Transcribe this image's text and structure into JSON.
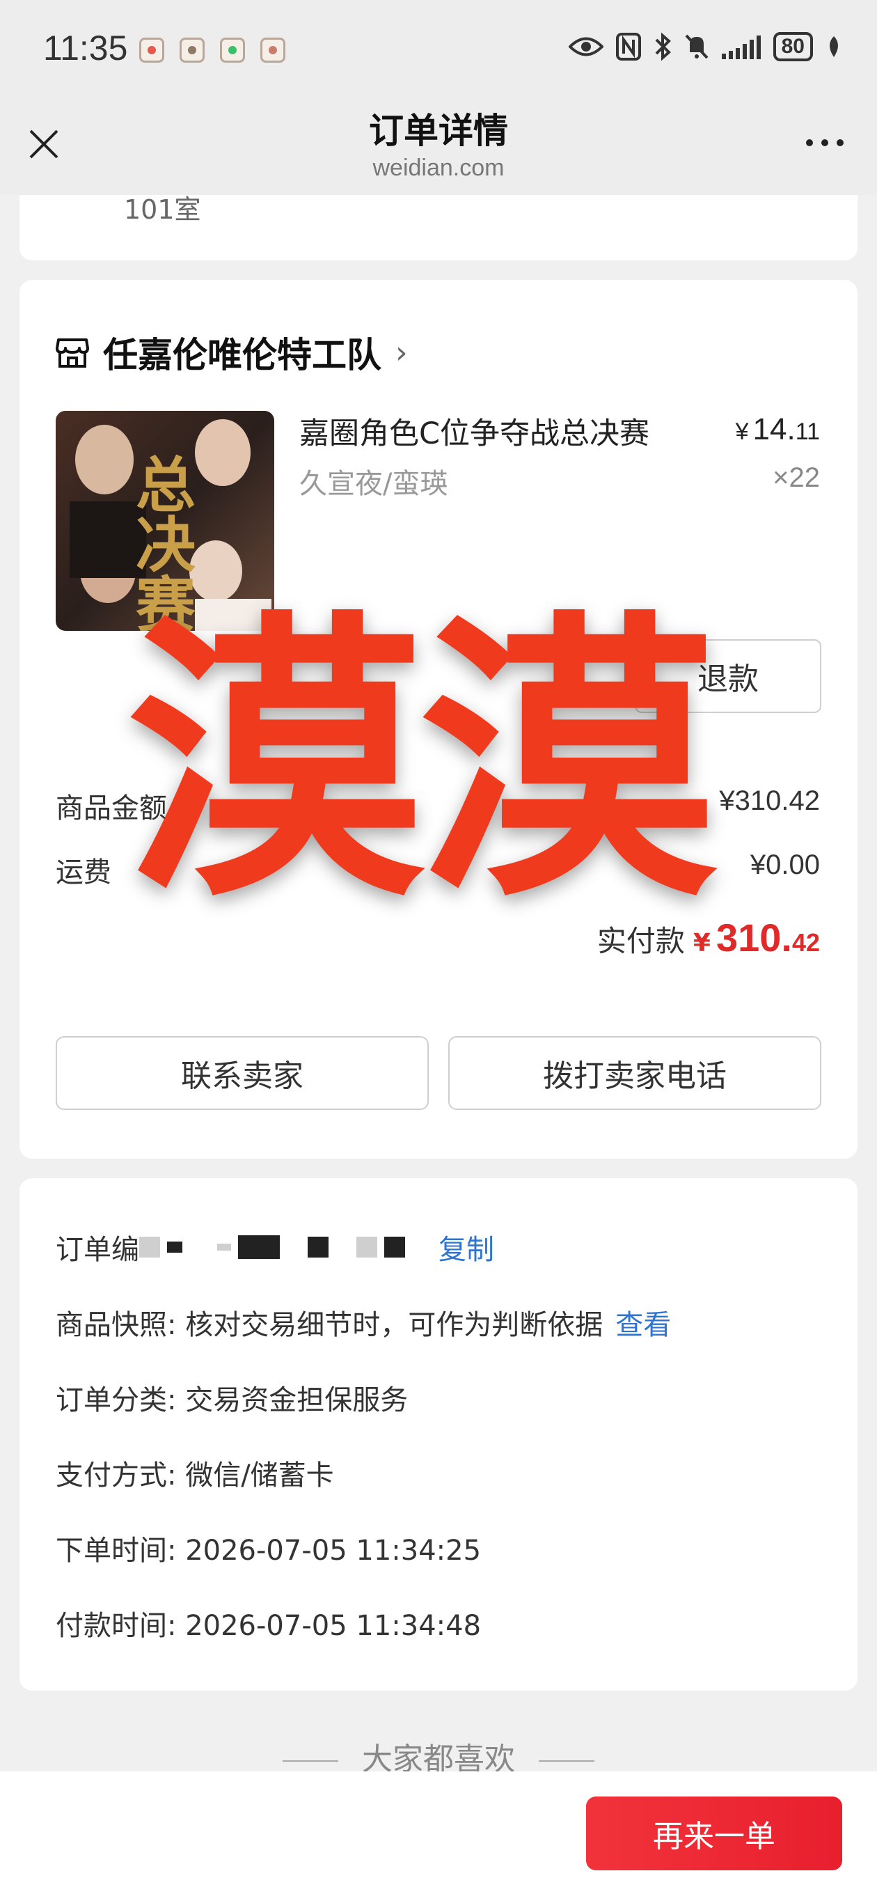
{
  "status_bar": {
    "time": "11:35",
    "battery": "80",
    "icons": [
      "eye-icon",
      "nfc-icon",
      "bluetooth-icon",
      "mute-icon",
      "signal-icon",
      "battery-icon",
      "leaf-icon"
    ]
  },
  "nav": {
    "title": "订单详情",
    "subtitle": "weidian.com"
  },
  "address": {
    "peek_text": "101室"
  },
  "order": {
    "shop_name": "任嘉伦唯伦特工队",
    "product": {
      "name": "嘉圈角色C位争夺战总决赛",
      "spec": "久宣夜/蛮瑛",
      "price_yen": "¥",
      "price_int": "14.",
      "price_dec": "11",
      "qty": "×22",
      "image_overlay_text": "总决赛"
    },
    "refund_label": "退款",
    "goods_amount_label": "商品金额",
    "goods_amount_value": "¥310.42",
    "shipping_label": "运费",
    "shipping_value": "¥0.00",
    "paid_label": "实付款",
    "paid_yen": "¥",
    "paid_int": "310.",
    "paid_dec": "42",
    "contact_label": "联系卖家",
    "call_label": "拨打卖家电话",
    "watermark": "漠漠"
  },
  "info": {
    "order_no_label": "订单编",
    "copy_label": "复制",
    "snapshot_text": "商品快照: 核对交易细节时，可作为判断依据",
    "snapshot_link": "查看",
    "category_text": "订单分类: 交易资金担保服务",
    "payment_text": "支付方式: 微信/储蓄卡",
    "order_time_text": "下单时间: 2026-07-05 11:34:25",
    "pay_time_text": "付款时间: 2026-07-05 11:34:48"
  },
  "recommend": {
    "title": "大家都喜欢"
  },
  "bottom": {
    "reorder_label": "再来一单"
  },
  "colors": {
    "accent_red": "#e02a2a",
    "link_blue": "#2f74d0",
    "watermark_red": "#f03a1d"
  }
}
